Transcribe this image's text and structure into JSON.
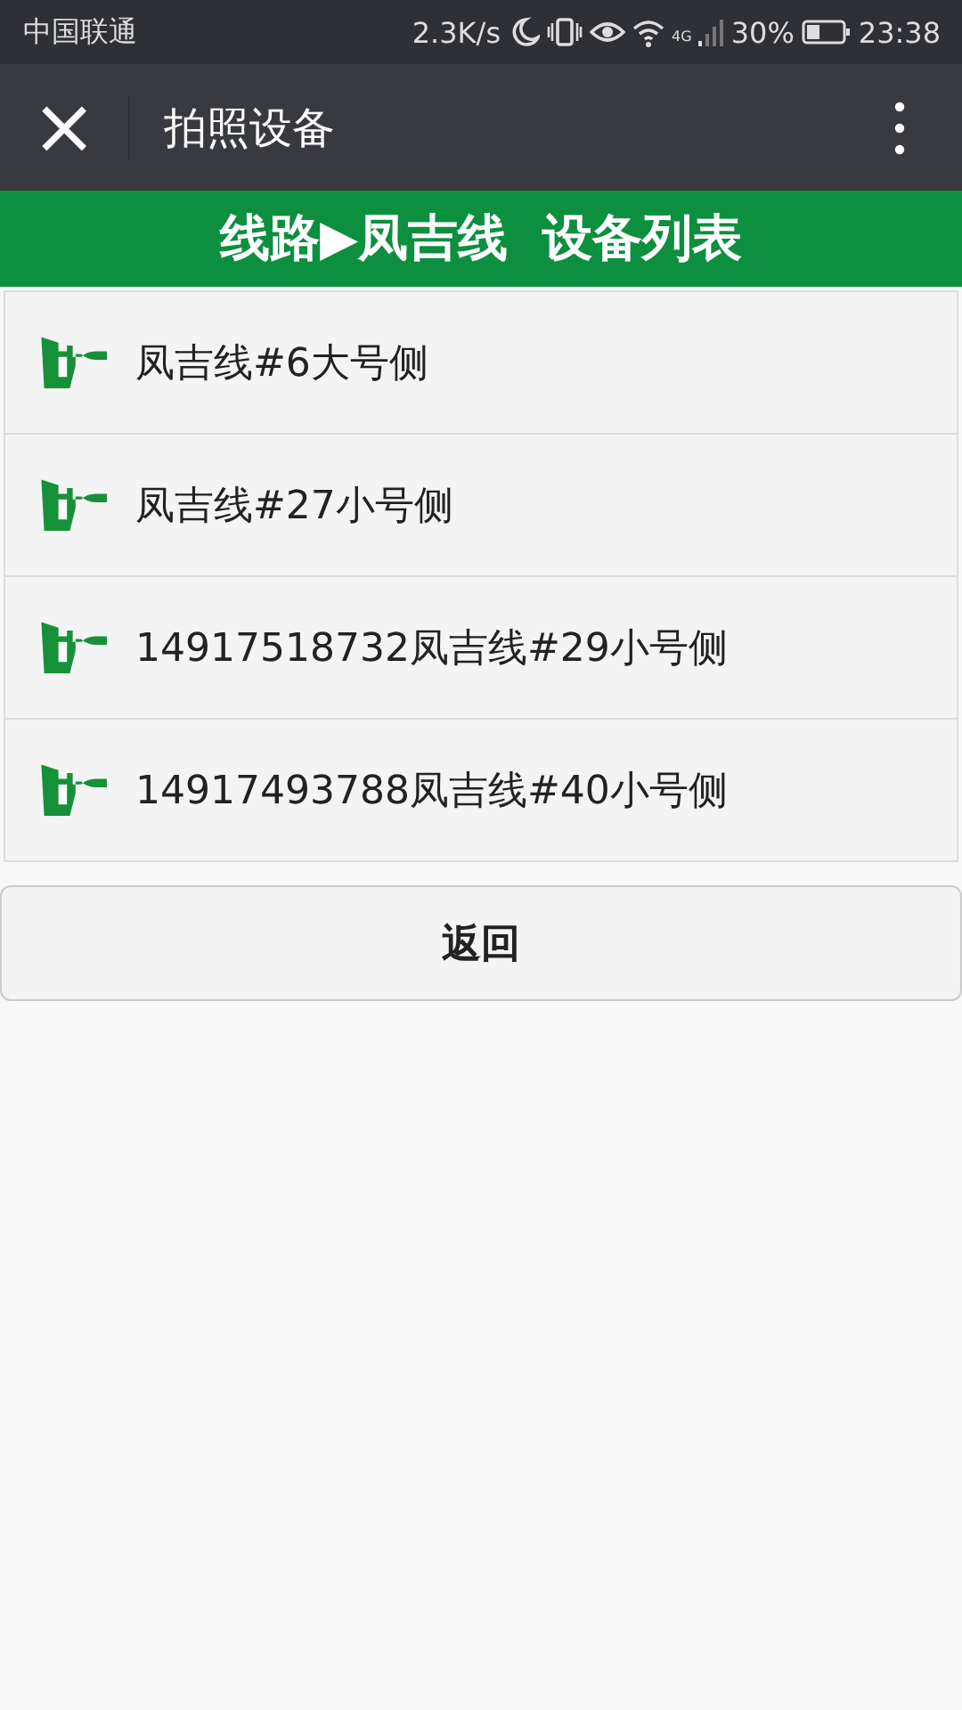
{
  "status_bar": {
    "carrier": "中国联通",
    "speed": "2.3K/s",
    "network": "4G",
    "battery": "30%",
    "time": "23:38"
  },
  "nav": {
    "close": "×",
    "title": "拍照设备"
  },
  "header": {
    "title": "线路▶凤吉线  设备列表"
  },
  "devices": [
    {
      "name": "凤吉线#6大号侧"
    },
    {
      "name": "凤吉线#27小号侧"
    },
    {
      "name": "14917518732凤吉线#29小号侧"
    },
    {
      "name": "14917493788凤吉线#40小号侧"
    }
  ],
  "buttons": [
    "返回"
  ]
}
